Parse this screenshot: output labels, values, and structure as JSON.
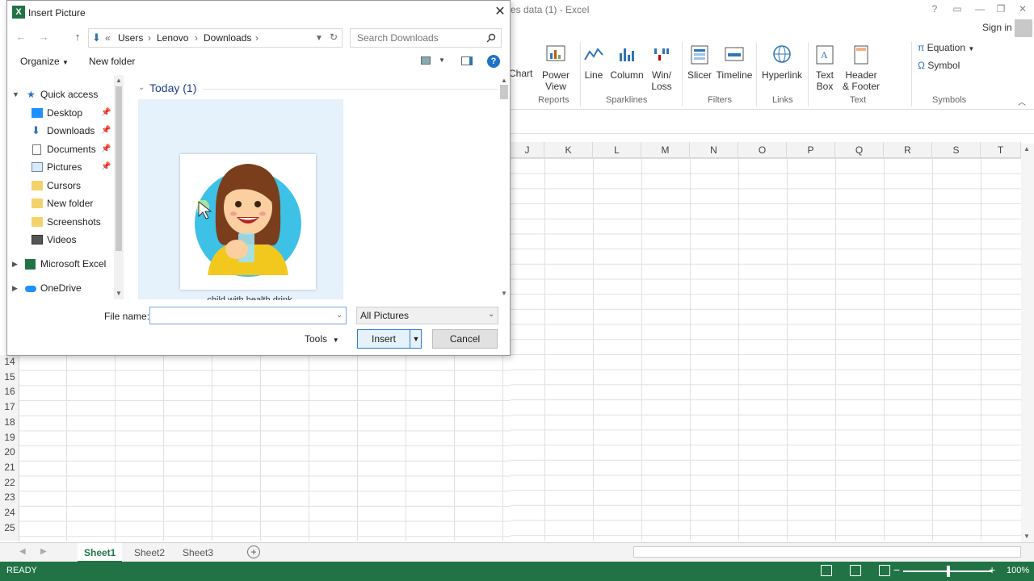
{
  "excel": {
    "title": "es data (1) - Excel",
    "signin": "Sign in",
    "ribbon": {
      "buttons": [
        "Chart",
        "Power View",
        "Line",
        "Column",
        "Win/ Loss",
        "Slicer",
        "Timeline",
        "Hyperlink",
        "Text Box",
        "Header & Footer",
        "Equation",
        "Symbol"
      ],
      "groups": [
        "Reports",
        "Sparklines",
        "Filters",
        "Links",
        "Text",
        "Symbols"
      ]
    },
    "columns": [
      "J",
      "K",
      "L",
      "M",
      "N",
      "O",
      "P",
      "Q",
      "R",
      "S",
      "T"
    ],
    "rows": [
      "14",
      "15",
      "16",
      "17",
      "18",
      "19",
      "20",
      "21",
      "22",
      "23",
      "24",
      "25"
    ],
    "sheets": [
      "Sheet1",
      "Sheet2",
      "Sheet3"
    ],
    "status": "READY",
    "zoom": "100%",
    "accent": "#217346"
  },
  "dialog": {
    "title": "Insert Picture",
    "breadcrumb": [
      "Users",
      "Lenovo",
      "Downloads"
    ],
    "search_placeholder": "Search Downloads",
    "organize": "Organize",
    "new_folder": "New folder",
    "nav": {
      "quick_access": "Quick access",
      "items": [
        "Desktop",
        "Downloads",
        "Documents",
        "Pictures",
        "Cursors",
        "New folder",
        "Screenshots",
        "Videos"
      ],
      "microsoft_excel": "Microsoft Excel",
      "onedrive": "OneDrive"
    },
    "group_header": "Today (1)",
    "file_name_label": "child with health drink",
    "file_name_field_label": "File name:",
    "file_name_value": "",
    "filter": "All Pictures",
    "tools": "Tools",
    "insert": "Insert",
    "cancel": "Cancel"
  }
}
